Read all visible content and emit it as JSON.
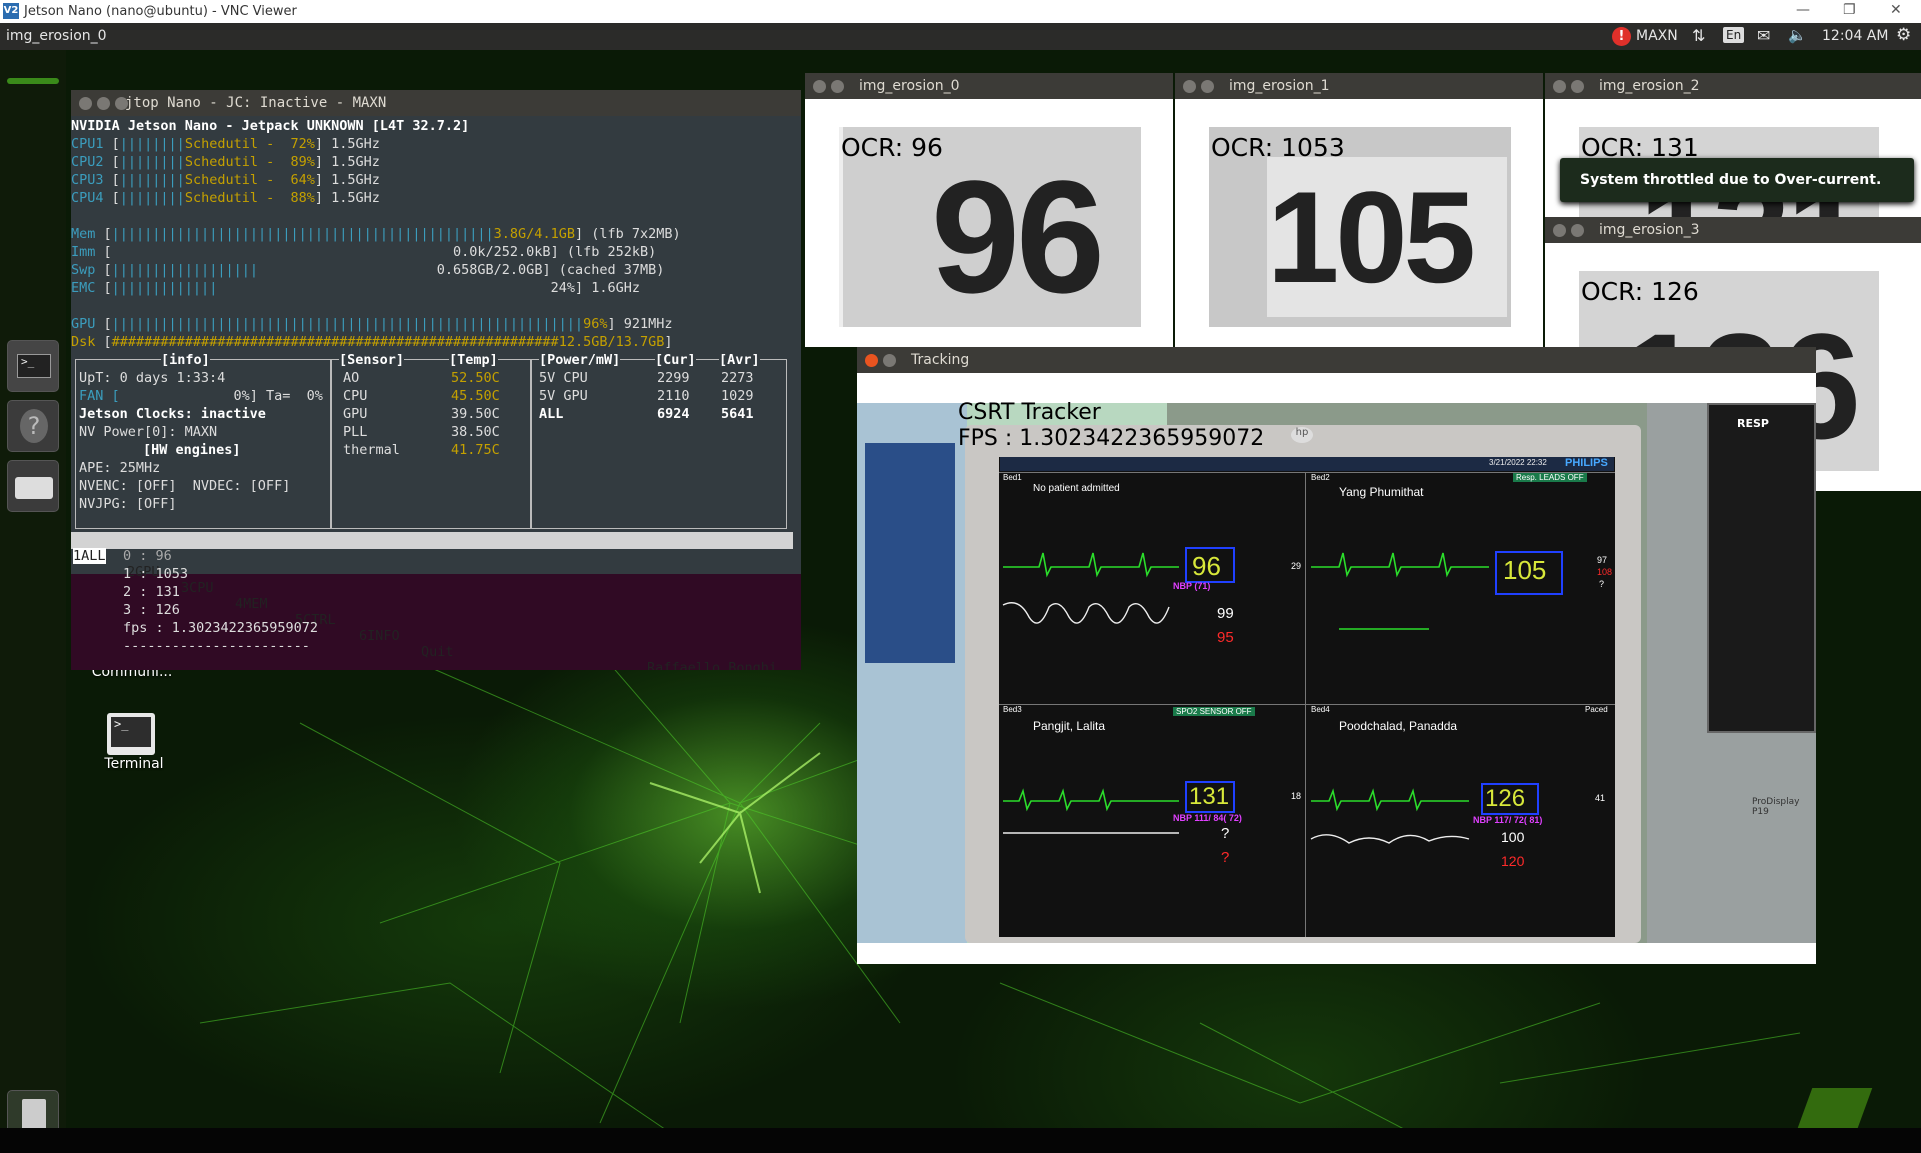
{
  "vnc": {
    "title": "Jetson Nano (nano@ubuntu) - VNC Viewer",
    "min": "—",
    "max": "❐",
    "close": "✕"
  },
  "topbar": {
    "app": "img_erosion_0",
    "power_mode": "MAXN",
    "lang": "En",
    "time": "12:04 AM"
  },
  "desktop_icons": [
    {
      "label": "Communi..."
    },
    {
      "label": "Terminal"
    }
  ],
  "terminal": {
    "title": "jtop Nano - JC: Inactive - MAXN",
    "header": "NVIDIA Jetson Nano - Jetpack UNKNOWN [L4T 32.7.2]",
    "cpus": [
      {
        "name": "CPU1",
        "gov": "Schedutil",
        "pct": "72%",
        "freq": "1.5GHz"
      },
      {
        "name": "CPU2",
        "gov": "Schedutil",
        "pct": "89%",
        "freq": "1.5GHz"
      },
      {
        "name": "CPU3",
        "gov": "Schedutil",
        "pct": "64%",
        "freq": "1.5GHz"
      },
      {
        "name": "CPU4",
        "gov": "Schedutil",
        "pct": "88%",
        "freq": "1.5GHz"
      }
    ],
    "mem": {
      "label": "Mem",
      "val": "3.8G/4.1GB",
      "extra": "(lfb 7x2MB)"
    },
    "imm": {
      "label": "Imm",
      "val": "0.0k/252.0kB",
      "extra": "(lfb 252kB)"
    },
    "swp": {
      "label": "Swp",
      "val": "0.658GB/2.0GB",
      "extra": "(cached 37MB)"
    },
    "emc": {
      "label": "EMC",
      "val": "24%",
      "extra": "1.6GHz"
    },
    "gpu": {
      "label": "GPU",
      "val": "96%",
      "extra": "921MHz"
    },
    "dsk": {
      "label": "Dsk",
      "val": "12.5GB/13.7GB"
    },
    "info": {
      "title": "[info]",
      "uptime": "UpT: 0 days 1:33:4",
      "fan": "FAN [",
      "fan_val": "0%] Ta=  0%",
      "clocks": "Jetson Clocks: inactive",
      "nvpower": "NV Power[0]: MAXN",
      "hw": "[HW engines]",
      "ape": "APE: 25MHz",
      "nvenc": "NVENC: [OFF]  NVDEC: [OFF]",
      "nvjpg": "NVJPG: [OFF]"
    },
    "sensor": {
      "head_s": "[Sensor]",
      "head_t": "[Temp]",
      "rows": [
        {
          "n": "AO",
          "t": "52.50C"
        },
        {
          "n": "CPU",
          "t": "45.50C"
        },
        {
          "n": "GPU",
          "t": "39.50C"
        },
        {
          "n": "PLL",
          "t": "38.50C"
        },
        {
          "n": "thermal",
          "t": "41.75C"
        }
      ]
    },
    "power": {
      "head_p": "[Power/mW]",
      "head_c": "[Cur]",
      "head_a": "[Avr]",
      "rows": [
        {
          "n": "5V CPU",
          "c": "2299",
          "a": "2273"
        },
        {
          "n": "5V GPU",
          "c": "2110",
          "a": "1029"
        },
        {
          "n": "ALL",
          "c": "6924",
          "a": "5641"
        }
      ]
    },
    "menu": [
      "1ALL",
      "2GPU",
      "3CPU",
      "4MEM",
      "5CTRL",
      "6INFO",
      "Quit"
    ],
    "author": "Raffaello Bonghi",
    "out": [
      "0 : 96",
      "1 : 1053",
      "2 : 131",
      "3 : 126",
      "fps : 1.3023422365959072",
      "-----------------------"
    ]
  },
  "ocr_windows": [
    {
      "title": "img_erosion_0",
      "ocr": "OCR: 96",
      "digits": "96"
    },
    {
      "title": "img_erosion_1",
      "ocr": "OCR: 1053",
      "digits": "105"
    },
    {
      "title": "img_erosion_2",
      "ocr": "OCR: 131",
      "digits": "131"
    },
    {
      "title": "img_erosion_3",
      "ocr": "OCR: 126",
      "digits": "126"
    }
  ],
  "notification": "System throttled due to Over-current.",
  "tracking": {
    "title": "Tracking",
    "tracker": "CSRT Tracker",
    "fps": "FPS : 1.3023422365959072",
    "brand": "PHILIPS",
    "date": "3/21/2022  22:32",
    "resp_tag": "Resp. LEADS OFF",
    "spo2_tag": "SPO2 SENSOR OFF",
    "beds": [
      {
        "bed": "Bed1",
        "name": "No patient admitted",
        "hr": "96",
        "nbp": "NBP (71)",
        "spo2": "99",
        "pulse": "95",
        "resp": "29"
      },
      {
        "bed": "Bed2",
        "name": "Yang Phumithat",
        "hr": "105",
        "spo2": "97",
        "pulse": "108",
        "resp": "?"
      },
      {
        "bed": "Bed3",
        "name": "Pangjit, Lalita",
        "hr": "131",
        "nbp": "NBP 111/ 84( 72)",
        "spo2": "?",
        "pulse": "?",
        "resp": "18"
      },
      {
        "bed": "Bed4",
        "name": "Poodchalad, Panadda",
        "hr": "126",
        "nbp": "NBP 117/ 72( 81)",
        "spo2": "100",
        "pulse": "120",
        "resp": "41"
      }
    ],
    "side_label": "RESP",
    "paced": "Paced",
    "prodisplay": "ProDisplay P19"
  }
}
